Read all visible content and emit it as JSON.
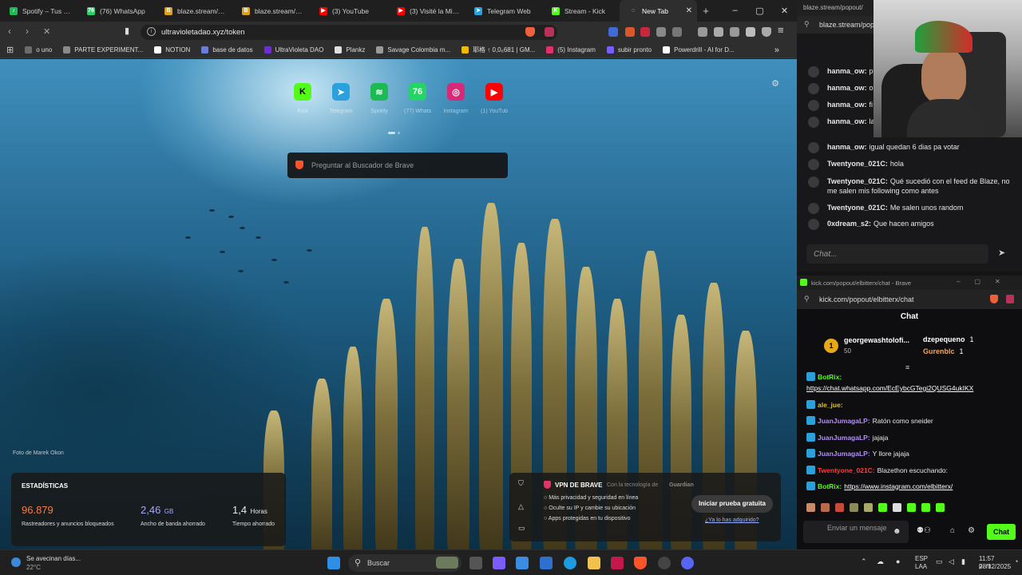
{
  "browser": {
    "tabs": [
      {
        "label": "Spotify – Tus me",
        "icon": "spotify-icon",
        "color": "#1db954",
        "glyph": "♪"
      },
      {
        "label": "(76) WhatsApp",
        "icon": "whatsapp-icon",
        "color": "#25d366",
        "glyph": "76"
      },
      {
        "label": "blaze.stream/stre",
        "icon": "blaze-icon",
        "color": "#e0a21b",
        "glyph": "B"
      },
      {
        "label": "blaze.stream/stre",
        "icon": "blaze-icon",
        "color": "#e0a21b",
        "glyph": "B"
      },
      {
        "label": "(3) YouTube",
        "icon": "youtube-icon",
        "color": "#ff0000",
        "glyph": "▶"
      },
      {
        "label": "(3) Visité la Miste",
        "icon": "youtube-icon",
        "color": "#ff0000",
        "glyph": "▶"
      },
      {
        "label": "Telegram Web",
        "icon": "telegram-icon",
        "color": "#2aa1da",
        "glyph": "➤"
      },
      {
        "label": "Stream - Kick",
        "icon": "kick-icon",
        "color": "#53fc18",
        "glyph": "K"
      },
      {
        "label": "New Tab",
        "icon": "loading-icon",
        "color": "#2e2e2e",
        "glyph": "◌"
      }
    ],
    "url": "ultravioletadao.xyz/token",
    "bookmarks": [
      {
        "label": "o uno",
        "color": "#6c6c6c"
      },
      {
        "label": "PARTE EXPERIMENT...",
        "color": "#8a8a8a"
      },
      {
        "label": "NOTION",
        "color": "#ffffff"
      },
      {
        "label": "base de datos",
        "color": "#6b7bd8"
      },
      {
        "label": "UltraVioleta DAO",
        "color": "#6f2bd9"
      },
      {
        "label": "Plankz",
        "color": "#e0e0e0"
      },
      {
        "label": "Savage Colombia m...",
        "color": "#9a9a9a"
      },
      {
        "label": "耶格 ↑ 0,0₆681 | GM...",
        "color": "#f0b90b"
      },
      {
        "label": "(5) Instagram",
        "color": "#e1306c"
      },
      {
        "label": "subir pronto",
        "color": "#7b5cff"
      },
      {
        "label": "Powerdrill - AI for D...",
        "color": "#ffffff"
      }
    ]
  },
  "newtab": {
    "shortcuts": [
      {
        "label": "Kick",
        "glyph": "K",
        "color": "#53fc18",
        "fg": "#000"
      },
      {
        "label": "Telegram",
        "glyph": "➤",
        "color": "#2aa1da",
        "fg": "#fff"
      },
      {
        "label": "Spotify",
        "glyph": "≋",
        "color": "#1db954",
        "fg": "#fff"
      },
      {
        "label": "(77) Whats...",
        "glyph": "76",
        "color": "#25d366",
        "fg": "#fff"
      },
      {
        "label": "Instagram",
        "glyph": "◎",
        "color": "#d62976",
        "fg": "#fff"
      },
      {
        "label": "(1) YouTube",
        "glyph": "▶",
        "color": "#ff0000",
        "fg": "#fff"
      }
    ],
    "search_placeholder": "Preguntar al Buscador de Brave",
    "photo_credit": "Foto de Marek Okon",
    "stats": {
      "title": "ESTADÍSTICAS",
      "trackers": {
        "value": "96.879",
        "desc": "Rastreadores y anuncios bloqueados",
        "color": "#ff7a45"
      },
      "bandwidth": {
        "value": "2,46",
        "unit": "GB",
        "desc": "Ancho de banda ahorrado",
        "color": "#a8a5ff"
      },
      "time": {
        "value": "1,4",
        "unit": "Horas",
        "desc": "Tiempo ahorrado",
        "color": "#ffffff"
      }
    },
    "vpn": {
      "title": "VPN DE BRAVE",
      "powered": "Con la tecnología de",
      "guardian": "Guardian",
      "points": [
        "Más privacidad y seguridad en línea",
        "Oculte su IP y cambie su ubicación",
        "Apps protegidas en tu dispositivo"
      ],
      "trial": "Iniciar prueba gratuita",
      "purchased": "¿Ya lo has adquirido?"
    }
  },
  "blaze_chat": {
    "title": "blaze.stream/popout/",
    "url": "blaze.stream/pop",
    "messages": [
      {
        "user": "hanma_ow:",
        "text": "p"
      },
      {
        "user": "hanma_ow:",
        "text": "o"
      },
      {
        "user": "hanma_ow:",
        "text": "fi"
      },
      {
        "user": "hanma_ow:",
        "text": "la stream despi"
      },
      {
        "user": "hanma_ow:",
        "text": "igual quedan 6 dias pa votar"
      },
      {
        "user": "Twentyone_021C:",
        "text": "hola"
      },
      {
        "user": "Twentyone_021C:",
        "text": "Qué sucedió con el feed de Blaze, no me salen mis following como antes"
      },
      {
        "user": "Twentyone_021C:",
        "text": "Me salen unos random"
      },
      {
        "user": "0xdream_s2:",
        "text": "Que hacen amigos"
      }
    ],
    "input_placeholder": "Chat..."
  },
  "kick_chat": {
    "window_title": "kick.com/popout/elbitterx/chat - Brave",
    "url": "kick.com/popout/elbitterx/chat",
    "header": "Chat",
    "leader": {
      "rank": "1",
      "name": "georgewashtolofi...",
      "points": "50"
    },
    "gifters": [
      {
        "name": "dzepequeno",
        "count": "1"
      },
      {
        "name": "Gurenblc",
        "count": "1"
      }
    ],
    "messages": [
      {
        "user": "BotRix:",
        "text": "",
        "color": "#53fc18",
        "link": ""
      },
      {
        "user": "",
        "text": "",
        "color": "#fff",
        "link": "https://chat.whatsapp.com/EcEybcGTegi2QUSG4ukIKX"
      },
      {
        "user": "ale_jue:",
        "text": "",
        "color": "#e0c21b",
        "link": ""
      },
      {
        "user": "JuanJumagaLP:",
        "text": "Ratón como sneider",
        "color": "#b28cff",
        "link": ""
      },
      {
        "user": "JuanJumagaLP:",
        "text": "jajaja",
        "color": "#b28cff",
        "link": ""
      },
      {
        "user": "JuanJumagaLP:",
        "text": "Y llore jajaja",
        "color": "#b28cff",
        "link": ""
      },
      {
        "user": "Twentyone_021C:",
        "text": "Blazethon escuchando:",
        "color": "#ff3b3b",
        "link": ""
      },
      {
        "user": "BotRix:",
        "text": "",
        "color": "#53fc18",
        "link": "https://www.instagram.com/elbitterx/"
      }
    ],
    "input_placeholder": "Enviar un mensaje",
    "chat_button": "Chat"
  },
  "taskbar": {
    "weather_text": "Se avecinan días...",
    "weather_temp": "22°C",
    "search_label": "Buscar",
    "lang": "ESP",
    "lang2": "LAA",
    "time": "11:57 p. m.",
    "date": "28/12/2025"
  }
}
